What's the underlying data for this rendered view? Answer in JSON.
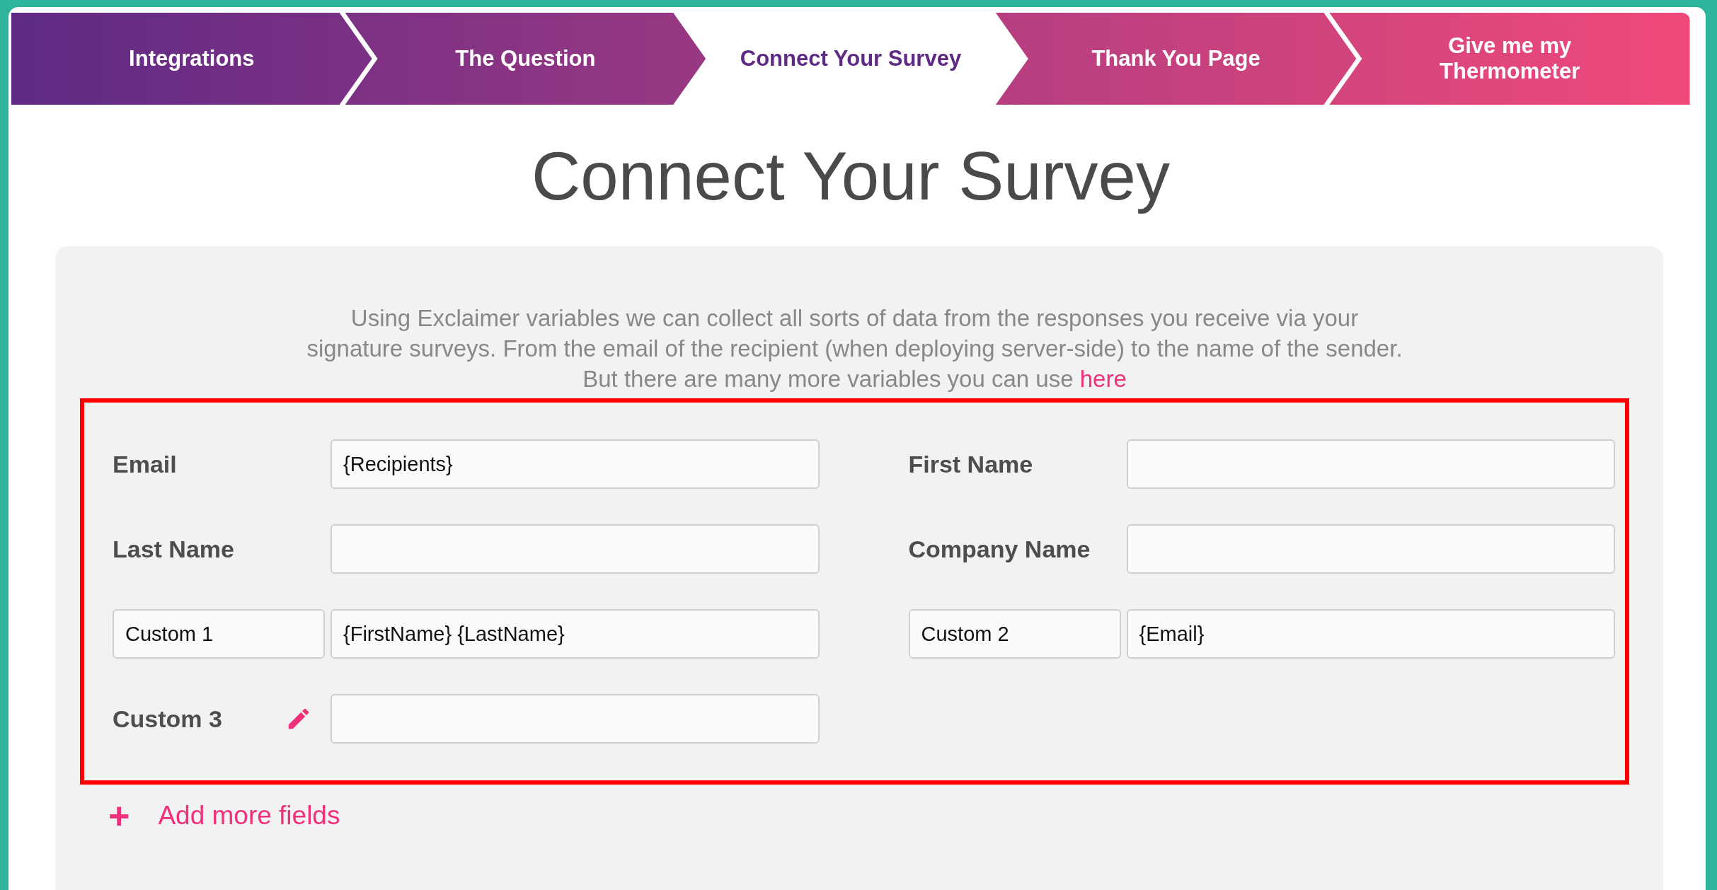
{
  "steps": [
    {
      "label": "Integrations",
      "selected": false
    },
    {
      "label": "The Question",
      "selected": false
    },
    {
      "label": "Connect Your Survey",
      "selected": true
    },
    {
      "label": "Thank You Page",
      "selected": false
    },
    {
      "label": "Give me my Thermometer",
      "selected": false
    }
  ],
  "title": "Connect Your Survey",
  "intro": {
    "text": "Using Exclaimer variables we can collect all sorts of data from the responses you receive via your signature surveys. From the email of the recipient (when deploying server-side) to the name of the sender.",
    "more": "But there are many more variables you can use",
    "link": "here"
  },
  "fields": [
    {
      "kind": "label",
      "label": "Email",
      "value": "{Recipients}"
    },
    {
      "kind": "label",
      "label": "First Name"
    },
    {
      "kind": "label",
      "label": "Last Name"
    },
    {
      "kind": "label",
      "label": "Company Name"
    },
    {
      "kind": "custom",
      "label": "Custom 1",
      "value": "{FirstName} {LastName}"
    },
    {
      "kind": "custom",
      "label": "Custom 2",
      "value": "{Email}"
    },
    {
      "kind": "editable",
      "label": "Custom 3"
    }
  ],
  "add_button": {
    "icon": "+",
    "label": "Add more fields"
  }
}
